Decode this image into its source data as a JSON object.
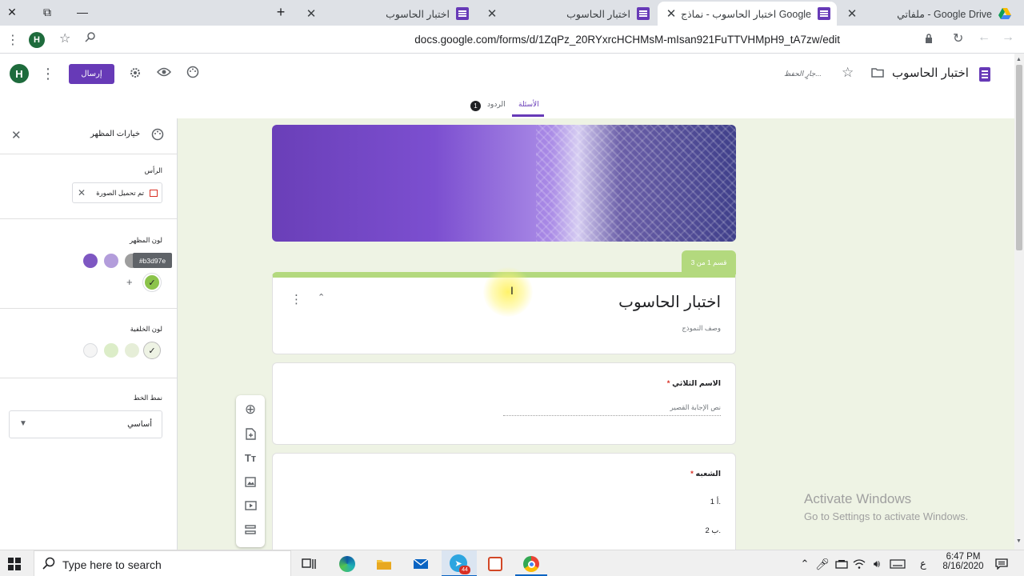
{
  "browser": {
    "tabs": [
      {
        "title": "ملفاتي - Google Drive",
        "icon": "google-drive-icon"
      },
      {
        "title": "اختبار الحاسوب - نماذج Google",
        "icon": "google-forms-icon",
        "active": true
      },
      {
        "title": "اختبار الحاسوب",
        "icon": "google-forms-icon"
      },
      {
        "title": "اختبار الحاسوب",
        "icon": "google-forms-icon"
      }
    ],
    "url": "docs.google.com/forms/d/1ZqPz_20RYxrcHCHMsM-mIsan921FuTTVHMpH9_tA7zw/edit",
    "profile_initial": "H"
  },
  "form_header": {
    "doc_title": "اختبار الحاسوب",
    "saving_status": "جارٍ الحفظ...",
    "send_label": "إرسال",
    "profile_initial": "H",
    "tab_questions": "الأسئلة",
    "tab_responses": "الردود",
    "responses_count": "1"
  },
  "theme_panel": {
    "title": "خيارات المظهر",
    "header_label": "الرأس",
    "image_uploaded": "تم تحميل الصورة",
    "theme_color_label": "لون المظهر",
    "color_tooltip": "#b3d97e",
    "theme_colors": [
      "#7e57c2",
      "#b39ddb",
      "#9e9e9e"
    ],
    "selected_color": "#8bc34a",
    "background_color_label": "لون الخلفية",
    "background_colors": [
      "#f5f5f5",
      "#dcedc8",
      "#e6eed8",
      "#eef3e4"
    ],
    "font_style_label": "نمط الخط",
    "font_style_value": "أساسي"
  },
  "form": {
    "section_badge": "قسم 1 من 3",
    "title": "اختبار الحاسوب",
    "description_placeholder": "وصف النموذج",
    "questions": [
      {
        "title": "الاسم الثلاثي",
        "required": "*",
        "answer_placeholder": "نص الإجابة القصير"
      },
      {
        "title": "الشعبه",
        "required": "*",
        "options": [
          {
            "num": "1.",
            "text": "أ"
          },
          {
            "num": "2.",
            "text": "ب"
          }
        ]
      }
    ],
    "accent": "#8bc34a",
    "brand": "#673ab7"
  },
  "watermark": {
    "line1": "Activate Windows",
    "line2": "Go to Settings to activate Windows."
  },
  "taskbar": {
    "search_placeholder": "Type here to search",
    "time": "6:47 PM",
    "date": "8/16/2020",
    "lang": "ع",
    "mail_badge": "44"
  }
}
